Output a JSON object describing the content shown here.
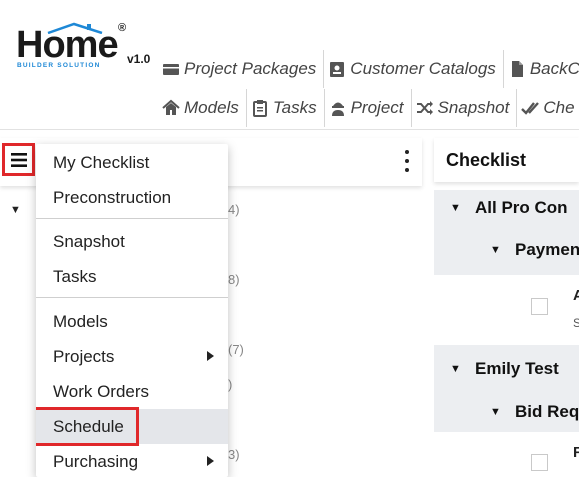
{
  "logo": {
    "word": "Home",
    "subtitle": "BUILDER SOLUTION",
    "registered": "®",
    "version": "v1.0"
  },
  "nav": {
    "row1": [
      {
        "label": "Project Packages",
        "icon": "truck-icon"
      },
      {
        "label": "Customer Catalogs",
        "icon": "id-card-icon"
      },
      {
        "label": "BackCh",
        "icon": "file-icon"
      }
    ],
    "row2": [
      {
        "label": "Models",
        "icon": "home-icon"
      },
      {
        "label": "Tasks",
        "icon": "clipboard-icon"
      },
      {
        "label": "Project",
        "icon": "user-hardhat-icon"
      },
      {
        "label": "Snapshot",
        "icon": "shuffle-icon"
      },
      {
        "label": "Che",
        "icon": "double-check-icon"
      }
    ]
  },
  "left_panel": {
    "counts": [
      "4)",
      "8)",
      "(7)",
      ")",
      "3)"
    ]
  },
  "menu": {
    "items": [
      {
        "label": "My Checklist",
        "has_submenu": false
      },
      {
        "label": "Preconstruction",
        "has_submenu": false
      },
      {
        "label": "Snapshot",
        "has_submenu": false
      },
      {
        "label": "Tasks",
        "has_submenu": false
      },
      {
        "label": "Models",
        "has_submenu": false
      },
      {
        "label": "Projects",
        "has_submenu": true
      },
      {
        "label": "Work Orders",
        "has_submenu": false
      },
      {
        "label": "Schedule",
        "has_submenu": false,
        "selected": true
      },
      {
        "label": "Purchasing",
        "has_submenu": true
      }
    ]
  },
  "checklist": {
    "title": "Checklist",
    "groups": [
      {
        "label": "All Pro Con",
        "sub": "Paymen",
        "item_text": "A",
        "item_sub": "S"
      },
      {
        "label": "Emily Test",
        "sub": "Bid Req",
        "item_text": "F"
      }
    ]
  },
  "colors": {
    "highlight_border": "#e0282a",
    "logo_blue": "#1e88d6",
    "group_bg": "#eceef1",
    "selected_bg": "#e4e6ea"
  }
}
